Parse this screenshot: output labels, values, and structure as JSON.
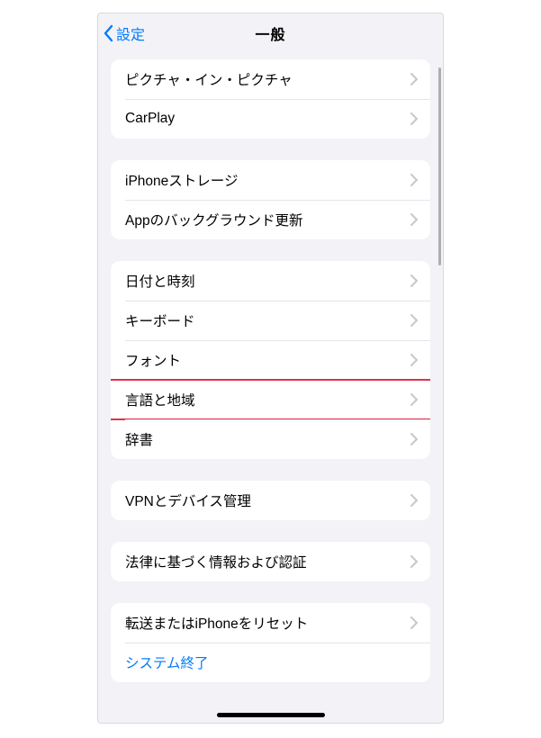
{
  "nav": {
    "back_label": "設定",
    "title": "一般"
  },
  "groups": [
    {
      "rows": [
        {
          "label": "ピクチャ・イン・ピクチャ",
          "disclosure": true
        },
        {
          "label": "CarPlay",
          "disclosure": true
        }
      ]
    },
    {
      "rows": [
        {
          "label": "iPhoneストレージ",
          "disclosure": true
        },
        {
          "label": "Appのバックグラウンド更新",
          "disclosure": true
        }
      ]
    },
    {
      "rows": [
        {
          "label": "日付と時刻",
          "disclosure": true
        },
        {
          "label": "キーボード",
          "disclosure": true
        },
        {
          "label": "フォント",
          "disclosure": true
        },
        {
          "label": "言語と地域",
          "disclosure": true,
          "highlighted": true
        },
        {
          "label": "辞書",
          "disclosure": true
        }
      ]
    },
    {
      "rows": [
        {
          "label": "VPNとデバイス管理",
          "disclosure": true
        }
      ]
    },
    {
      "rows": [
        {
          "label": "法律に基づく情報および認証",
          "disclosure": true
        }
      ]
    },
    {
      "rows": [
        {
          "label": "転送またはiPhoneをリセット",
          "disclosure": true
        },
        {
          "label": "システム終了",
          "disclosure": false,
          "link": true
        }
      ]
    }
  ]
}
